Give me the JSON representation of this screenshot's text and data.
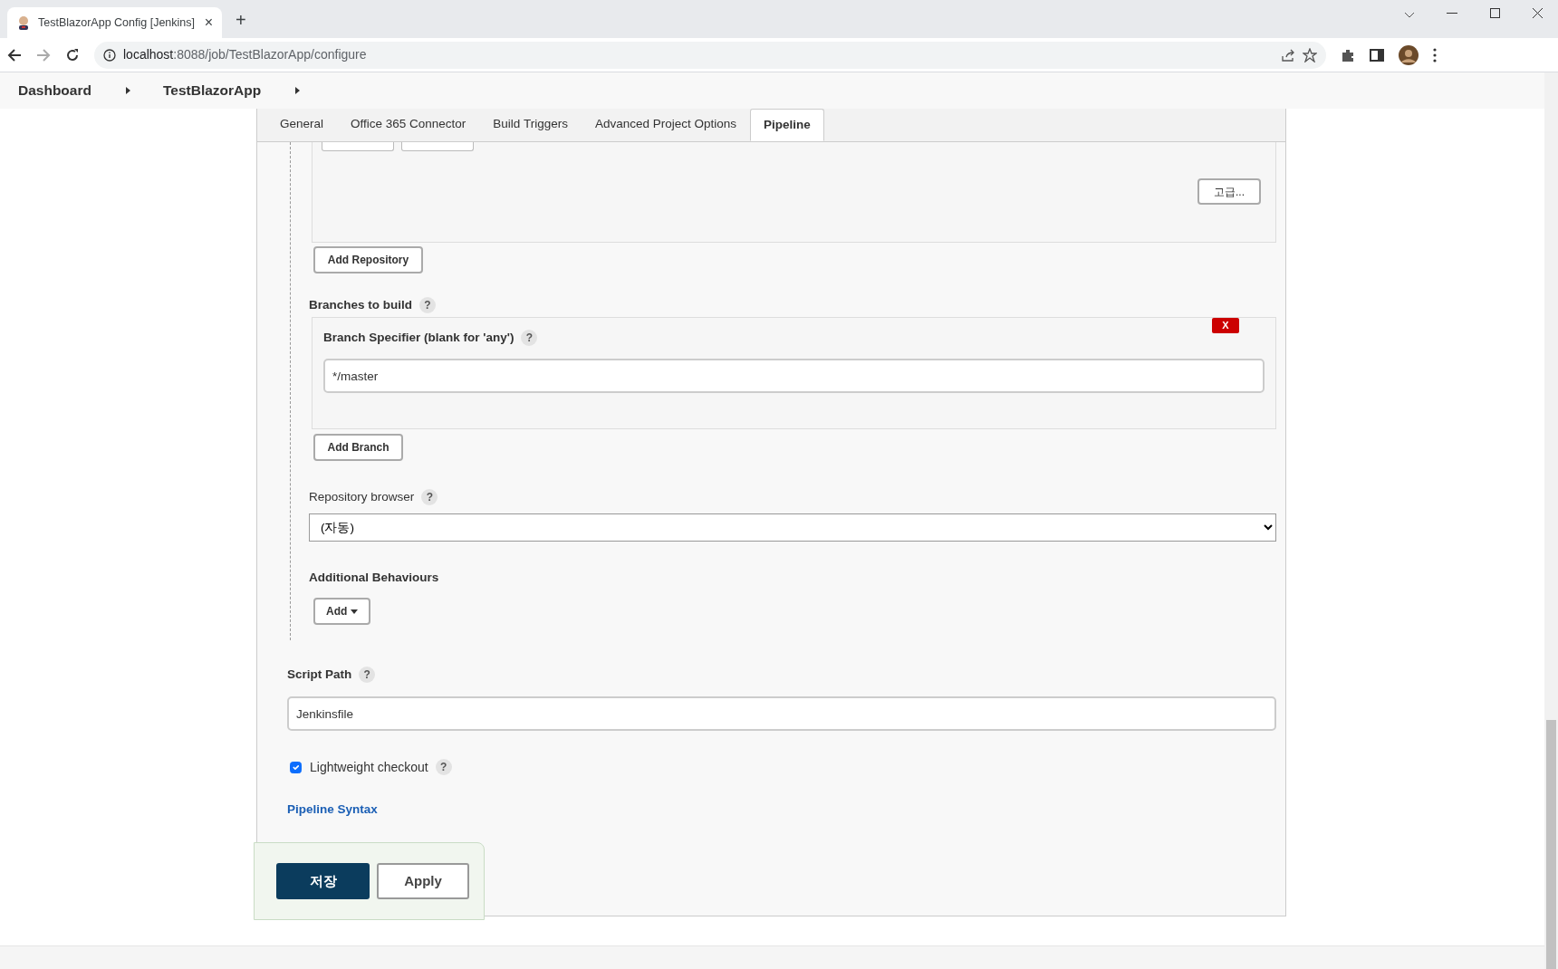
{
  "browser": {
    "tab_title": "TestBlazorApp Config [Jenkins]",
    "close": "×",
    "new_tab": "+",
    "url_host": "localhost",
    "url_rest": ":8088/job/TestBlazorApp/configure"
  },
  "breadcrumbs": [
    "Dashboard",
    "TestBlazorApp"
  ],
  "tabs": [
    {
      "label": "General",
      "selected": false
    },
    {
      "label": "Office 365 Connector",
      "selected": false
    },
    {
      "label": "Build Triggers",
      "selected": false
    },
    {
      "label": "Advanced Project Options",
      "selected": false
    },
    {
      "label": "Pipeline",
      "selected": true
    }
  ],
  "repository": {
    "advanced_button": "고급...",
    "add_repository": "Add Repository"
  },
  "branches": {
    "label": "Branches to build",
    "help": "?",
    "specifier_label": "Branch Specifier (blank for 'any')",
    "specifier_help": "?",
    "specifier_value": "*/master",
    "delete": "X",
    "add_branch": "Add Branch"
  },
  "repository_browser": {
    "label": "Repository browser",
    "help": "?",
    "value": "(자동)"
  },
  "additional_behaviours": {
    "label": "Additional Behaviours",
    "add": "Add"
  },
  "script_path": {
    "label": "Script Path",
    "help": "?",
    "value": "Jenkinsfile"
  },
  "lightweight_checkout": {
    "label": "Lightweight checkout",
    "help": "?",
    "checked": true
  },
  "pipeline_syntax": "Pipeline Syntax",
  "buttons": {
    "save": "저장",
    "apply": "Apply"
  }
}
